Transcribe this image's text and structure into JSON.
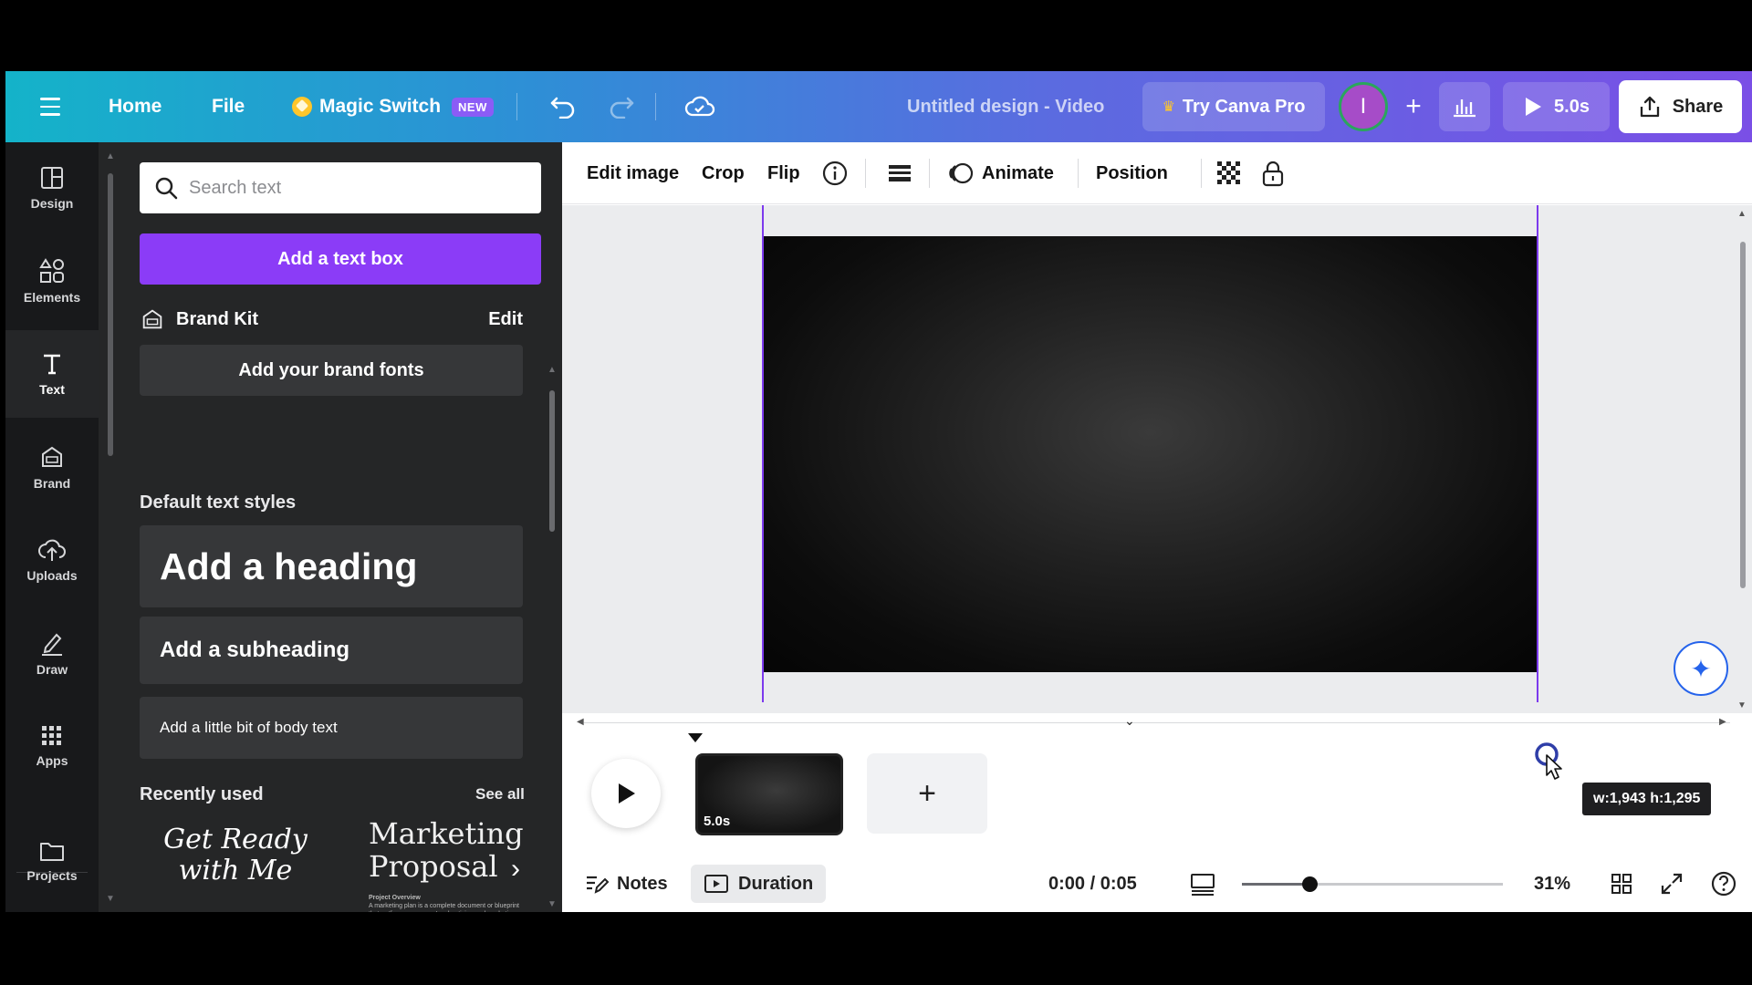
{
  "topbar": {
    "home": "Home",
    "file": "File",
    "magic_switch": "Magic Switch",
    "new_badge": "NEW",
    "design_title": "Untitled design - Video",
    "try_pro": "Try Canva Pro",
    "avatar_initial": "I",
    "play_duration": "5.0s",
    "share": "Share"
  },
  "rail": {
    "items": [
      {
        "label": "Design",
        "icon": "layout-icon"
      },
      {
        "label": "Elements",
        "icon": "shapes-icon"
      },
      {
        "label": "Text",
        "icon": "text-icon"
      },
      {
        "label": "Brand",
        "icon": "brand-icon"
      },
      {
        "label": "Uploads",
        "icon": "cloud-upload-icon"
      },
      {
        "label": "Draw",
        "icon": "pen-icon"
      },
      {
        "label": "Apps",
        "icon": "grid-icon"
      },
      {
        "label": "Projects",
        "icon": "folder-icon"
      }
    ],
    "active": "Text"
  },
  "panel": {
    "search_placeholder": "Search text",
    "add_text_box": "Add a text box",
    "brand_kit": "Brand Kit",
    "brand_kit_edit": "Edit",
    "add_brand_fonts": "Add your brand fonts",
    "default_styles_title": "Default text styles",
    "heading": "Add a heading",
    "subheading": "Add a subheading",
    "body": "Add a little bit of body text",
    "recently_used": "Recently used",
    "see_all": "See all",
    "recent_1_line1": "Get Ready",
    "recent_1_line2": "with Me",
    "recent_2_line1": "Marketing",
    "recent_2_line2": "Proposal",
    "recent_2_small_title": "Project Overview",
    "recent_2_small_text": "A marketing plan is a complete document or blueprint that outlines a company's advertising and marketing efforts for the coming year."
  },
  "toolbar": {
    "edit_image": "Edit image",
    "crop": "Crop",
    "flip": "Flip",
    "animate": "Animate",
    "position": "Position"
  },
  "timeline": {
    "clip_duration": "5.0s",
    "notes": "Notes",
    "duration": "Duration",
    "time": "0:00 / 0:05",
    "zoom": "31%",
    "zoom_fraction": 0.31,
    "dimensions": "w:1,943 h:1,295"
  },
  "colors": {
    "accent_purple": "#8b3cf7",
    "frame_purple": "#7c3aed",
    "panel_bg": "#252627"
  }
}
